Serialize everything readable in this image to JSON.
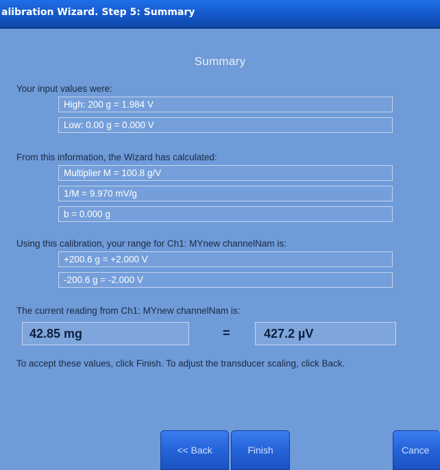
{
  "window": {
    "title": "alibration Wizard.  Step 5: Summary"
  },
  "summary": {
    "heading": "Summary",
    "input_label": "Your input values were:",
    "input_high": "High: 200  g  =  1.984  V",
    "input_low": "Low: 0.00  g = 0.000  V",
    "calc_label": "From this information, the Wizard has calculated:",
    "multiplier": "Multiplier M = 100.8  g/V",
    "inverse": "1/M = 9.970 mV/g",
    "offset": "b = 0.000  g",
    "range_label": "Using this calibration, your range for Ch1: MYnew channelNam is:",
    "range_pos": "+200.6  g = +2.000  V",
    "range_neg": "-200.6  g = -2.000  V",
    "reading_label": "The current reading from Ch1: MYnew channelNam is:",
    "reading_mass": "42.85 mg",
    "reading_equals": "=",
    "reading_voltage": "427.2 µV",
    "note": "To accept these values, click Finish.  To adjust the transducer scaling, click Back."
  },
  "buttons": {
    "back": "<< Back",
    "finish": "Finish",
    "cancel": "Cance"
  }
}
